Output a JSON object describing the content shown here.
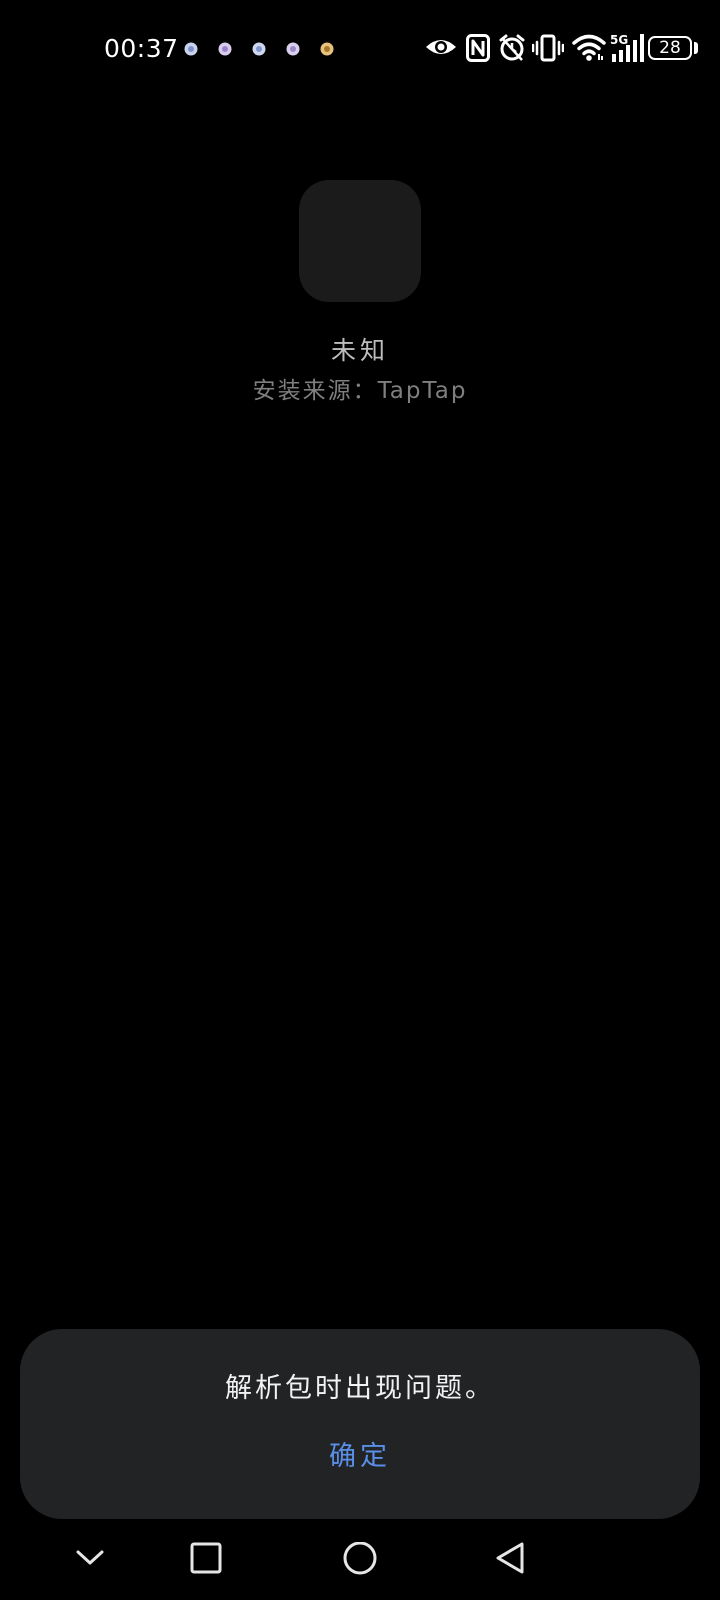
{
  "status_bar": {
    "time": "00:37",
    "battery_level": "28",
    "notification_icons": [
      "app-notification-icon",
      "app-notification-icon",
      "app-notification-icon",
      "app-notification-icon",
      "app-notification-icon"
    ],
    "system_icons": [
      "eye-comfort-icon",
      "nfc-icon",
      "alarm-icon",
      "vibrate-icon",
      "wifi-icon",
      "cellular-5g-icon",
      "battery-icon"
    ]
  },
  "app_info": {
    "name": "未知",
    "install_source": "安装来源：TapTap"
  },
  "dialog": {
    "message": "解析包时出现问题。",
    "confirm_label": "确定"
  },
  "colors": {
    "background": "#000000",
    "dialog_background": "#222325",
    "accent": "#5a8fe8"
  }
}
